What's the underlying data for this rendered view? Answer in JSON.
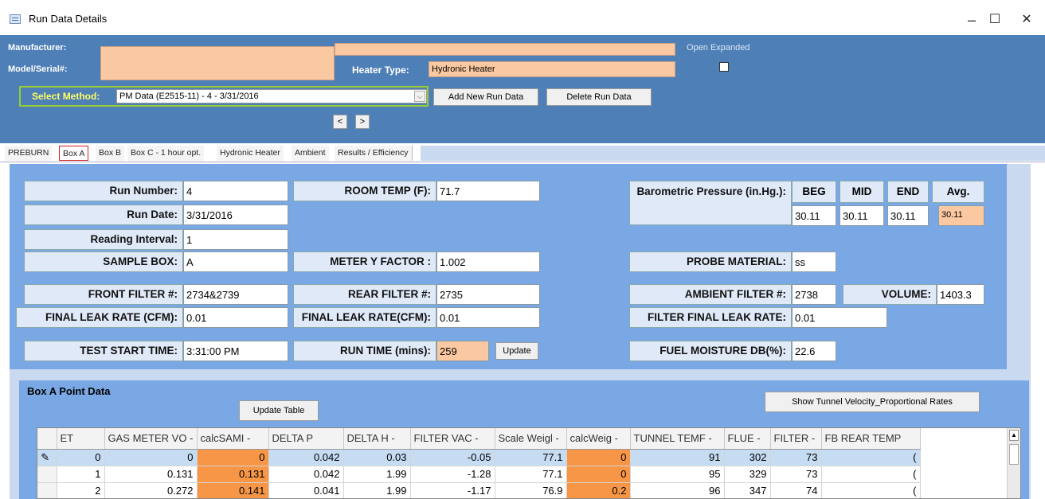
{
  "window": {
    "title": "Run Data Details",
    "minimize": "–",
    "maximize": "☐",
    "close": "✕"
  },
  "header": {
    "manufacturer_label": "Manufacturer:",
    "model_label": "Model/Serial#:",
    "heater_type_label": "Heater Type:",
    "heater_type_value": "Hydronic Heater",
    "open_expanded_label": "Open Expanded",
    "select_method_label": "Select Method:",
    "select_method_value": "PM Data (E2515-11) - 4 - 3/31/2016",
    "add_run_button": "Add New Run Data",
    "delete_run_button": "Delete Run Data",
    "prev_button": "<",
    "next_button": ">"
  },
  "tabs": [
    "PREBURN",
    "Box A",
    "Box B",
    "Box C - 1 hour opt.",
    "Hydronic Heater",
    "Ambient",
    "Results / Efficiency"
  ],
  "form": {
    "run_number_label": "Run Number:",
    "run_number": "4",
    "run_date_label": "Run Date:",
    "run_date": "3/31/2016",
    "reading_interval_label": "Reading Interval:",
    "reading_interval": "1",
    "sample_box_label": "SAMPLE BOX:",
    "sample_box": "A",
    "room_temp_label": "ROOM TEMP (F):",
    "room_temp": "71.7",
    "meter_y_label": "METER Y FACTOR :",
    "meter_y": "1.002",
    "baro_label": "Barometric Pressure (in.Hg.):",
    "baro_beg_label": "BEG",
    "baro_mid_label": "MID",
    "baro_end_label": "END",
    "baro_avg_label": "Avg.",
    "baro_beg": "30.11",
    "baro_mid": "30.11",
    "baro_end": "30.11",
    "baro_avg": "30.11",
    "probe_label": "PROBE MATERIAL:",
    "probe": "ss",
    "front_filter_label": "FRONT FILTER #:",
    "front_filter": "2734&2739",
    "final_leak_label": "FINAL LEAK RATE (CFM):",
    "final_leak": "0.01",
    "rear_filter_label": "REAR FILTER #:",
    "rear_filter": "2735",
    "final_leak2_label": "FINAL LEAK RATE(CFM):",
    "final_leak2": "0.01",
    "ambient_filter_label": "AMBIENT FILTER #:",
    "ambient_filter": "2738",
    "volume_label": "VOLUME:",
    "volume": "1403.3",
    "filter_final_leak_label": "FILTER FINAL LEAK RATE:",
    "filter_final_leak": "0.01",
    "test_start_label": "TEST START TIME:",
    "test_start": "3:31:00 PM",
    "run_time_label": "RUN TIME (mins):",
    "run_time": "259",
    "update_button": "Update",
    "fuel_moisture_label": "FUEL MOISTURE DB(%):",
    "fuel_moisture": "22.6"
  },
  "point_data": {
    "title": "Box A Point Data",
    "update_table_button": "Update Table",
    "show_tunnel_button": "Show Tunnel Velocity_Proportional Rates",
    "columns": [
      "ET",
      "GAS METER VO -",
      "calcSAMI -",
      "DELTA P",
      "DELTA H -",
      "FILTER VAC -",
      "Scale Weigl -",
      "calcWeig -",
      "TUNNEL TEMF -",
      "FLUE -",
      "FILTER -",
      "FB REAR TEMP"
    ],
    "rows": [
      {
        "marker": "✎",
        "cells": [
          "0",
          "0",
          "0",
          "0.042",
          "0.03",
          "-0.05",
          "77.1",
          "0",
          "91",
          "302",
          "73",
          "("
        ]
      },
      {
        "marker": "",
        "cells": [
          "1",
          "0.131",
          "0.131",
          "0.042",
          "1.99",
          "-1.28",
          "77.1",
          "0",
          "95",
          "329",
          "73",
          "("
        ]
      },
      {
        "marker": "",
        "cells": [
          "2",
          "0.272",
          "0.141",
          "0.041",
          "1.99",
          "-1.17",
          "76.9",
          "0.2",
          "96",
          "347",
          "74",
          "("
        ]
      }
    ]
  }
}
